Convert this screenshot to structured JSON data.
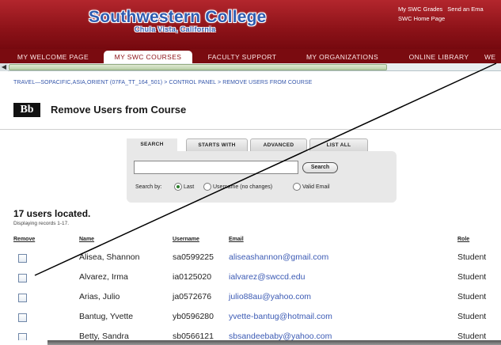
{
  "banner": {
    "logo_title": "Southwestern College",
    "logo_subtitle": "Chula Vista, California",
    "links": [
      "My SWC Grades",
      "Send an Ema",
      "SWC Home Page"
    ],
    "background": "#8c1218"
  },
  "tabs": [
    {
      "label": "MY WELCOME PAGE",
      "active": false
    },
    {
      "label": "MY SWC COURSES",
      "active": true
    },
    {
      "label": "FACULTY SUPPORT",
      "active": false
    },
    {
      "label": "MY ORGANIZATIONS",
      "active": false
    },
    {
      "label": "ONLINE LIBRARY",
      "active": false
    },
    {
      "label": "WE",
      "active": false
    }
  ],
  "breadcrumb": {
    "course": "TRAVEL—SOPACIFIC,ASIA,ORIENT (07FA_TT_164_501)",
    "sep": ">",
    "control_panel": "CONTROL PANEL",
    "current": "> REMOVE USERS FROM COURSE"
  },
  "page": {
    "logo": "Bb",
    "title": "Remove Users from Course"
  },
  "search": {
    "tabs": [
      "SEARCH",
      "STARTS WITH",
      "ADVANCED",
      "LIST ALL"
    ],
    "active_tab": "SEARCH",
    "query": "",
    "button_label": "Search",
    "search_by_label": "Search by:",
    "options": [
      {
        "label": "Last",
        "checked": true
      },
      {
        "label": "Username (no changes)",
        "checked": false
      },
      {
        "label": "Valid Email",
        "checked": false
      }
    ]
  },
  "results": {
    "count_label": "17 users located.",
    "displaying": "Displaying records 1-17.",
    "columns": {
      "remove": "Remove",
      "name": "Name",
      "username": "Username",
      "email": "Email",
      "role": "Role"
    },
    "rows": [
      {
        "name": "Alisea, Shannon",
        "username": "sa0599225",
        "email": "aliseashannon@gmail.com",
        "role": "Student"
      },
      {
        "name": "Alvarez, Irma",
        "username": "ia0125020",
        "email": "ialvarez@swccd.edu",
        "role": "Student"
      },
      {
        "name": "Arias, Julio",
        "username": "ja0572676",
        "email": "julio88au@yahoo.com",
        "role": "Student"
      },
      {
        "name": "Bantug, Yvette",
        "username": "yb0596280",
        "email": "yvette-bantug@hotmail.com",
        "role": "Student"
      },
      {
        "name": "Betty, Sandra",
        "username": "sb0566121",
        "email": "sbsandeebaby@yahoo.com",
        "role": "Student"
      }
    ]
  },
  "colors": {
    "link": "#3b5ab4",
    "tab_bar": "#7a0b10",
    "radio_checked": "#2a7d2a"
  }
}
